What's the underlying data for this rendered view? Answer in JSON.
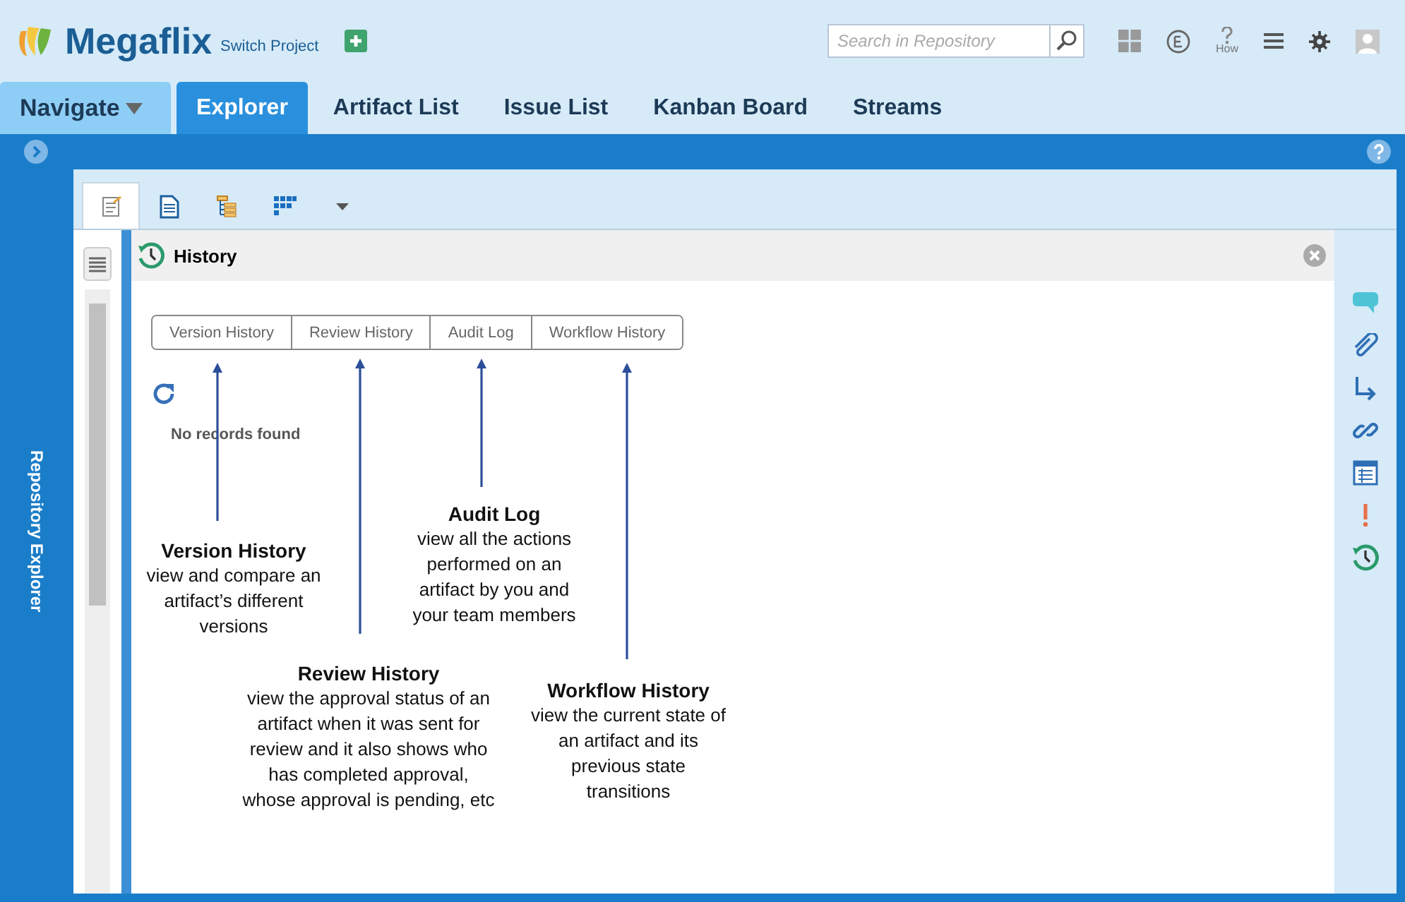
{
  "header": {
    "app_name": "Megaflix",
    "project_link": "Switch Project",
    "search": {
      "placeholder": "Search in Repository"
    },
    "how_label": "How"
  },
  "nav": [
    {
      "label": "Navigate",
      "kind": "dropdown",
      "selected": false
    },
    {
      "label": "Explorer",
      "kind": "tab",
      "selected": true
    },
    {
      "label": "Artifact List",
      "kind": "tab",
      "selected": false
    },
    {
      "label": "Issue List",
      "kind": "tab",
      "selected": false
    },
    {
      "label": "Kanban Board",
      "kind": "tab",
      "selected": false
    },
    {
      "label": "Streams",
      "kind": "tab",
      "selected": false
    }
  ],
  "sidebar": {
    "label": "Repository Explorer"
  },
  "view_tabs": [
    {
      "kind": "edit",
      "selected": true
    },
    {
      "kind": "document",
      "selected": false
    },
    {
      "kind": "tree",
      "selected": false
    },
    {
      "kind": "grid",
      "selected": false
    }
  ],
  "panel": {
    "title": "History",
    "tabs": [
      "Version History",
      "Review History",
      "Audit Log",
      "Workflow History"
    ],
    "empty_message": "No records found"
  },
  "annotations": [
    {
      "title": "Version History",
      "text": "view and compare an artifact’s different versions"
    },
    {
      "title": "Review History",
      "text": "view the approval status of an artifact when it was sent for review and it also shows who has completed approval, whose approval is pending, etc"
    },
    {
      "title": "Audit Log",
      "text": "view all the actions performed on an artifact by you and your team members"
    },
    {
      "title": "Workflow History",
      "text": "view the current state of an artifact and its previous state transitions"
    }
  ]
}
